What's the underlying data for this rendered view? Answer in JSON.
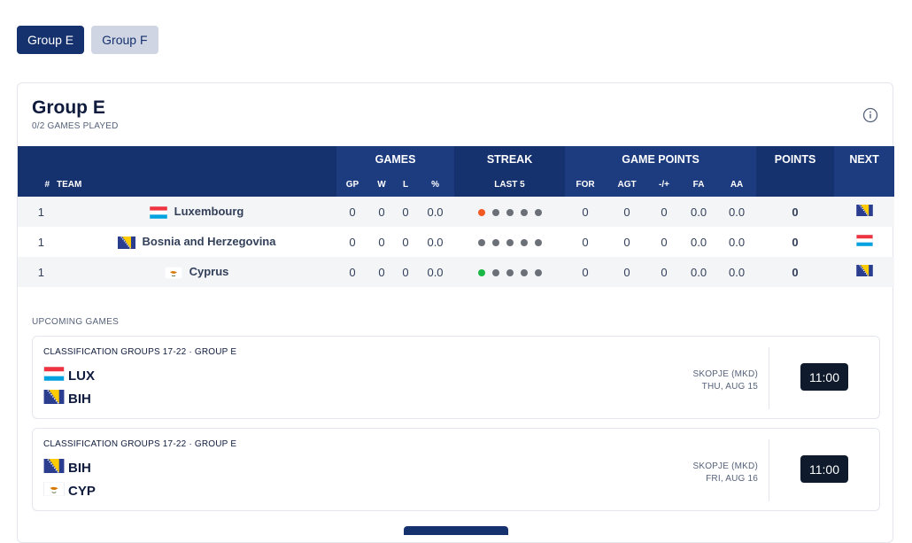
{
  "tabs": [
    {
      "label": "Group E",
      "active": true
    },
    {
      "label": "Group F",
      "active": false
    }
  ],
  "group": {
    "title": "Group E",
    "subtitle": "0/2 GAMES PLAYED"
  },
  "table": {
    "group_headers": {
      "games": "GAMES",
      "streak": "STREAK",
      "game_points": "GAME POINTS",
      "points": "POINTS",
      "next": "NEXT"
    },
    "columns": {
      "rank": "#",
      "team": "TEAM",
      "gp": "GP",
      "w": "W",
      "l": "L",
      "pct": "%",
      "last5": "LAST 5",
      "for": "FOR",
      "agt": "AGT",
      "diff": "-/+",
      "fa": "FA",
      "aa": "AA"
    },
    "rows": [
      {
        "rank": "1",
        "team": "Luxembourg",
        "flag": "lux",
        "gp": "0",
        "w": "0",
        "l": "0",
        "pct": "0.0",
        "streak": [
          "orange",
          "grey",
          "grey",
          "grey",
          "grey"
        ],
        "for": "0",
        "agt": "0",
        "diff": "0",
        "fa": "0.0",
        "aa": "0.0",
        "points": "0",
        "next_flag": "bih"
      },
      {
        "rank": "1",
        "team": "Bosnia and Herzegovina",
        "flag": "bih",
        "gp": "0",
        "w": "0",
        "l": "0",
        "pct": "0.0",
        "streak": [
          "grey",
          "grey",
          "grey",
          "grey",
          "grey"
        ],
        "for": "0",
        "agt": "0",
        "diff": "0",
        "fa": "0.0",
        "aa": "0.0",
        "points": "0",
        "next_flag": "lux"
      },
      {
        "rank": "1",
        "team": "Cyprus",
        "flag": "cyp",
        "gp": "0",
        "w": "0",
        "l": "0",
        "pct": "0.0",
        "streak": [
          "green",
          "grey",
          "grey",
          "grey",
          "grey"
        ],
        "for": "0",
        "agt": "0",
        "diff": "0",
        "fa": "0.0",
        "aa": "0.0",
        "points": "0",
        "next_flag": "bih"
      }
    ]
  },
  "upcoming": {
    "label": "UPCOMING GAMES",
    "games": [
      {
        "competition": "CLASSIFICATION GROUPS 17-22 · GROUP E",
        "home": "LUX",
        "home_flag": "lux",
        "away": "BIH",
        "away_flag": "bih",
        "venue": "SKOPJE (MKD)",
        "date": "THU, AUG 15",
        "time": "11:00"
      },
      {
        "competition": "CLASSIFICATION GROUPS 17-22 · GROUP E",
        "home": "BIH",
        "home_flag": "bih",
        "away": "CYP",
        "away_flag": "cyp",
        "venue": "SKOPJE (MKD)",
        "date": "FRI, AUG 16",
        "time": "11:00"
      }
    ]
  },
  "colors": {
    "primary": "#16326e",
    "inactive_tab": "#cfd5e3",
    "time_badge": "#0f1b2d",
    "streak_loss": "#f15a22",
    "streak_win": "#1bb845",
    "streak_none": "#6b6f77"
  },
  "icons": {
    "info": "info-circle-icon"
  }
}
